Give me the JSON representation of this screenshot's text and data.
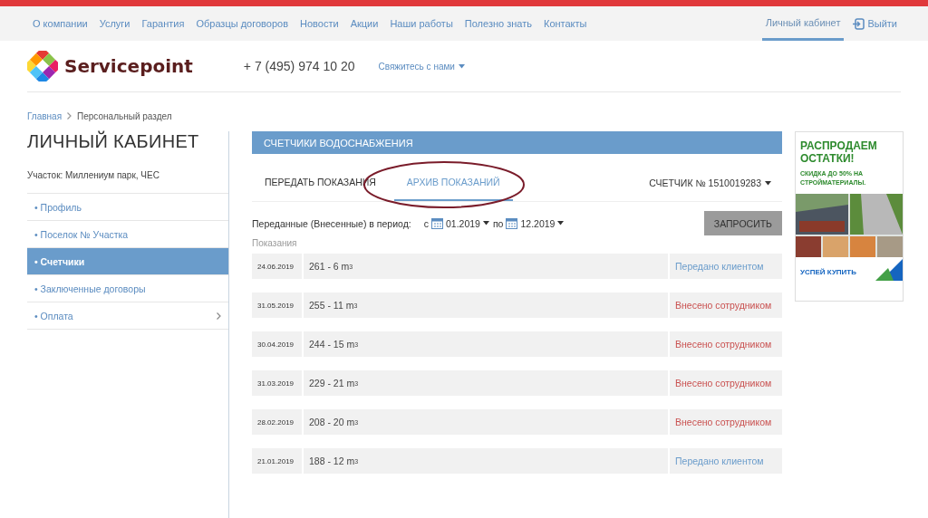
{
  "top_nav": {
    "items": [
      {
        "label": "О компании"
      },
      {
        "label": "Услуги"
      },
      {
        "label": "Гарантия"
      },
      {
        "label": "Образцы договоров"
      },
      {
        "label": "Новости"
      },
      {
        "label": "Акции"
      },
      {
        "label": "Наши работы"
      },
      {
        "label": "Полезно знать"
      },
      {
        "label": "Контакты"
      }
    ],
    "account": {
      "label": "Личный кабинет",
      "selected": true
    },
    "logout": "Выйти"
  },
  "header": {
    "logo": "Servicepoint",
    "phone": "+ 7 (495) 974 10 20",
    "contact": "Свяжитесь с нами"
  },
  "breadcrumb": [
    "Главная",
    "Персональный раздел"
  ],
  "sidebar": {
    "title": "ЛИЧНЫЙ КАБИНЕТ",
    "plot": "Участок: Миллениум парк, ЧЕС",
    "items": [
      {
        "label": "• Профиль",
        "selected": false,
        "has_submenu": false
      },
      {
        "label": "• Поселок № Участка",
        "selected": false,
        "has_submenu": false
      },
      {
        "label": "• Счетчики",
        "selected": true,
        "has_submenu": false
      },
      {
        "label": "• Заключенные договоры",
        "selected": false,
        "has_submenu": false
      },
      {
        "label": "• Оплата",
        "selected": false,
        "has_submenu": true
      }
    ]
  },
  "panel": {
    "title": "СЧЕТЧИКИ ВОДОСНАБЖЕНИЯ",
    "tabs": [
      {
        "label": "ПЕРЕДАТЬ ПОКАЗАНИЯ",
        "selected": false
      },
      {
        "label": "АРХИВ ПОКАЗАНИЙ",
        "selected": true
      }
    ],
    "meter": "СЧЕТЧИК № 1510019283",
    "filter": {
      "label": "Переданные (Внесенные) в период:",
      "from_prefix": "с",
      "from": "01.2019",
      "to_prefix": "по",
      "to": "12.2019",
      "button": "ЗАПРОСИТЬ"
    },
    "list_label": "Показания",
    "rows": [
      {
        "date": "24.06.2019",
        "reading": "261 - 6 m$^{3}$",
        "status": "Передано клиентом",
        "kind": "client"
      },
      {
        "date": "31.05.2019",
        "reading": "255 - 11 m$^{3}$",
        "status": "Внесено сотрудником",
        "kind": "staff"
      },
      {
        "date": "30.04.2019",
        "reading": "244 - 15 m$^{3}$",
        "status": "Внесено сотрудником",
        "kind": "staff"
      },
      {
        "date": "31.03.2019",
        "reading": "229 - 21 m$^{3}$",
        "status": "Внесено сотрудником",
        "kind": "staff"
      },
      {
        "date": "28.02.2019",
        "reading": "208 - 20 m$^{3}$",
        "status": "Внесено сотрудником",
        "kind": "staff"
      },
      {
        "date": "21.01.2019",
        "reading": "188 - 12 m$^{3}$",
        "status": "Передано клиентом",
        "kind": "client"
      }
    ]
  },
  "banner": {
    "headline": "РАСПРОДАЕМ ОСТАТКИ!",
    "subline": "СКИДКА ДО 50% НА СТРОЙМАТЕРИАЛЫ.",
    "cta": "УСПЕЙ КУПИТЬ"
  }
}
